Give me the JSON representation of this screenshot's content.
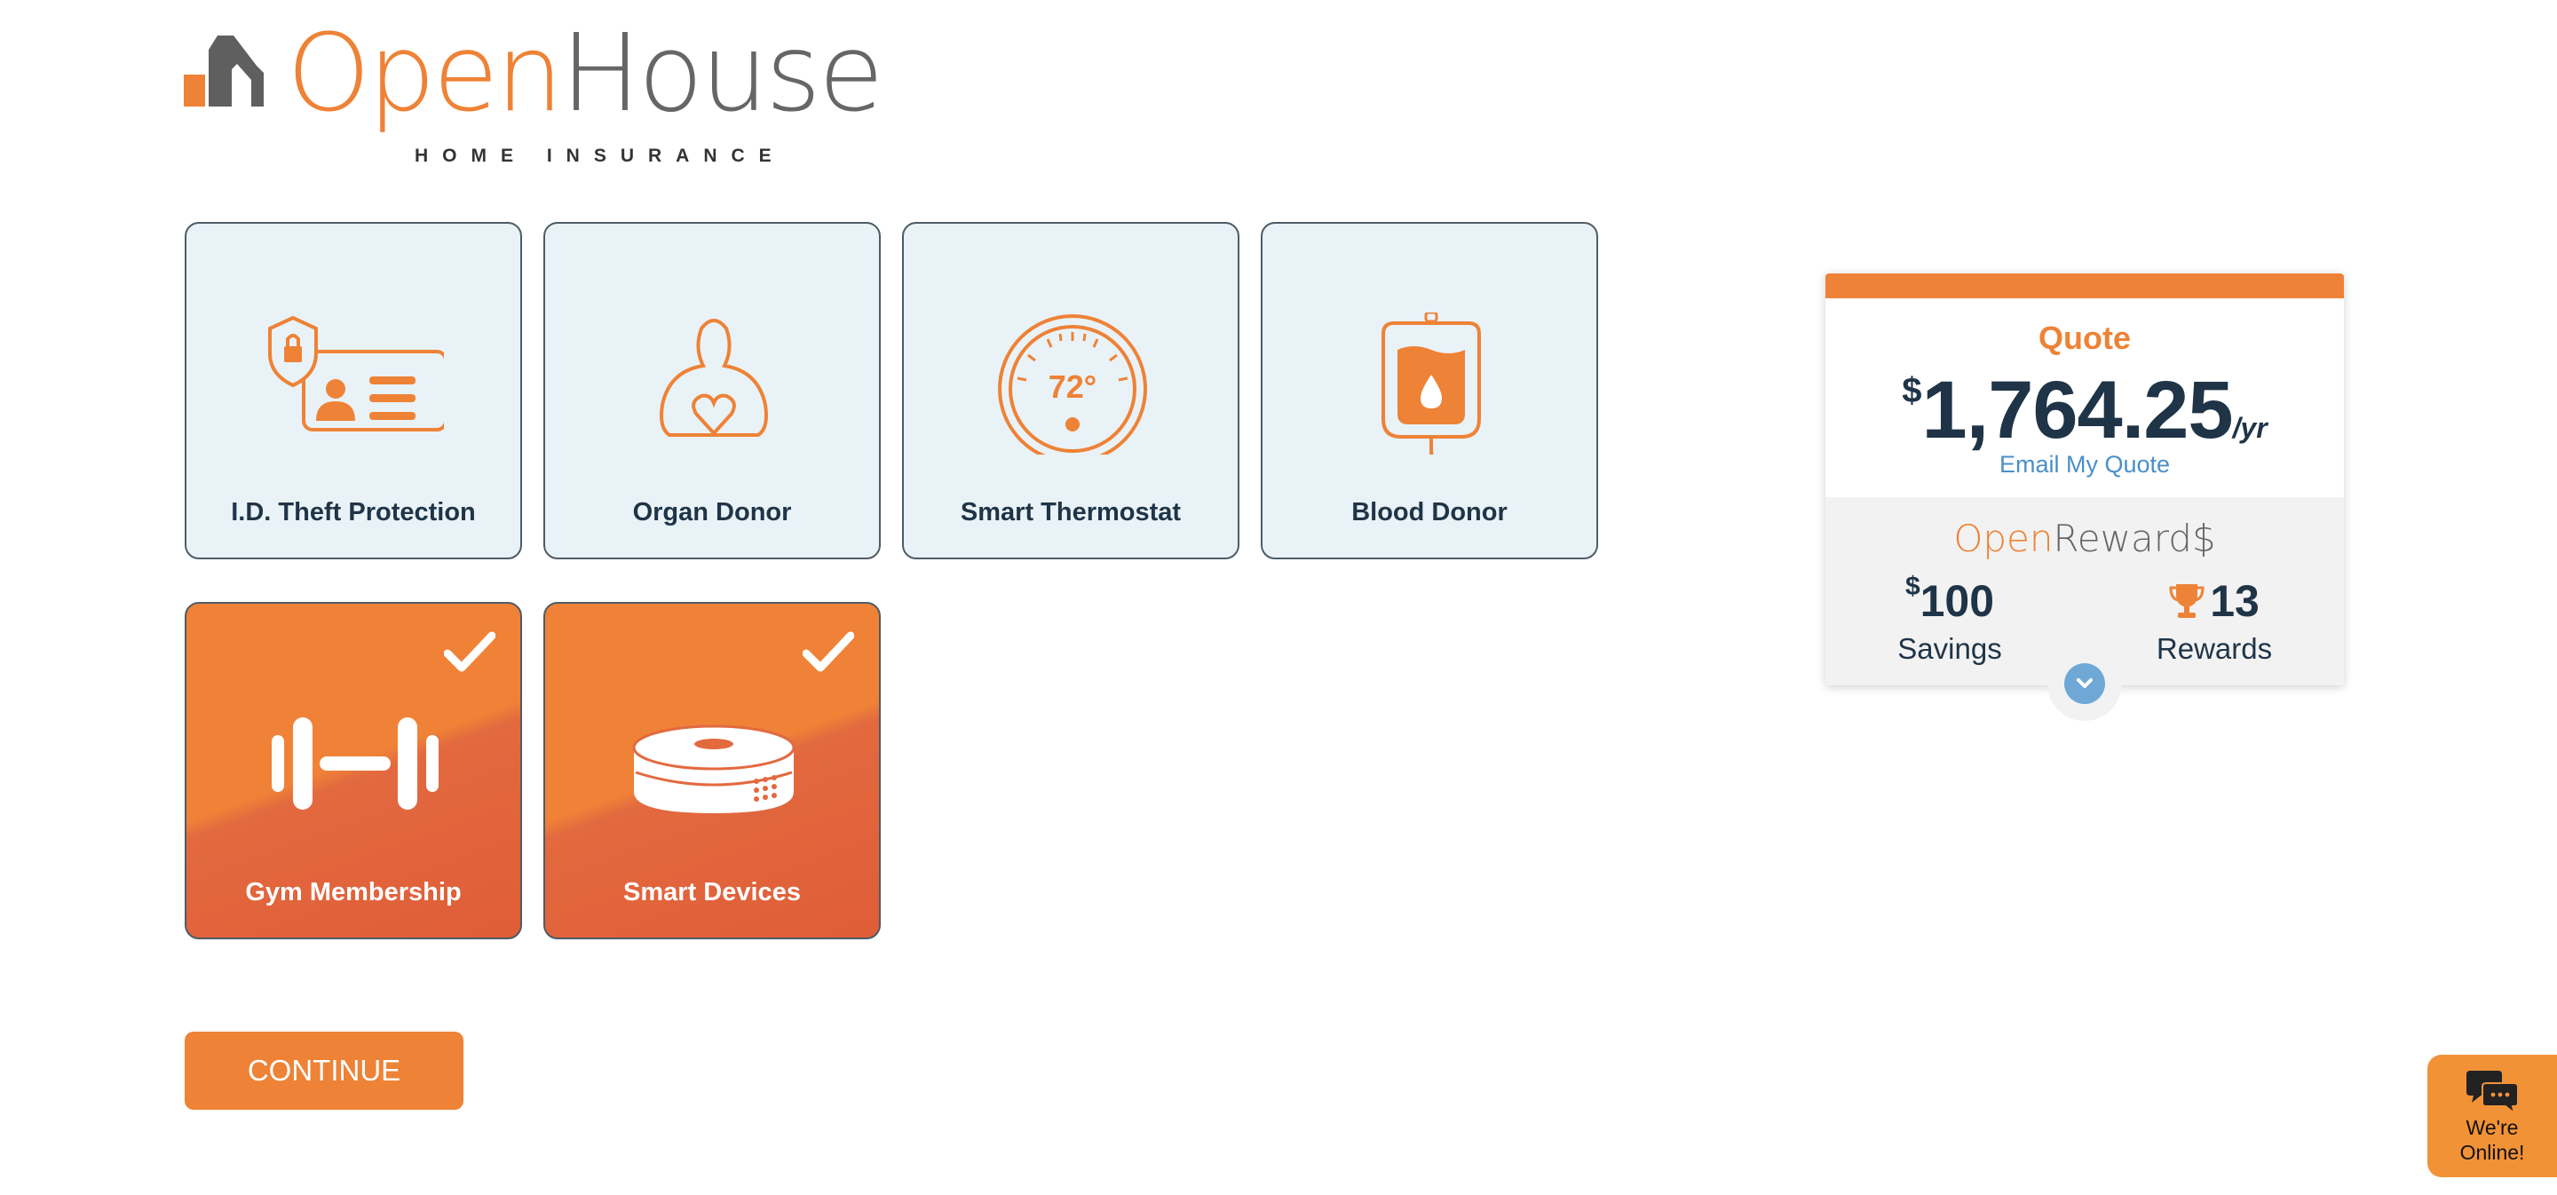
{
  "brand": {
    "word_open": "Open",
    "word_house": "House",
    "tagline": "HOME INSURANCE",
    "orange": "#ee8236",
    "navy": "#1f3447"
  },
  "tiles": [
    {
      "label": "I.D. Theft Protection",
      "icon": "id-card-shield-icon",
      "selected": false
    },
    {
      "label": "Organ Donor",
      "icon": "organ-donor-icon",
      "selected": false
    },
    {
      "label": "Smart Thermostat",
      "icon": "thermostat-icon",
      "selected": false,
      "icon_text": "72°"
    },
    {
      "label": "Blood Donor",
      "icon": "blood-bag-icon",
      "selected": false
    },
    {
      "label": "Gym Membership",
      "icon": "dumbbell-icon",
      "selected": true
    },
    {
      "label": "Smart Devices",
      "icon": "smart-device-icon",
      "selected": true
    }
  ],
  "quote": {
    "title": "Quote",
    "currency": "$",
    "amount": "1,764.25",
    "period": "/yr",
    "email_link": "Email My Quote"
  },
  "rewards": {
    "title_open": "Open",
    "title_rest": "Reward$",
    "savings_currency": "$",
    "savings_value": "100",
    "savings_caption": "Savings",
    "rewards_value": "13",
    "rewards_caption": "Rewards"
  },
  "continue_label": "CONTINUE",
  "chat": {
    "line1": "We're",
    "line2": "Online!"
  }
}
